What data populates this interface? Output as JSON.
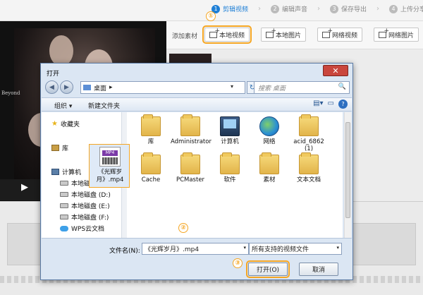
{
  "steps": [
    {
      "num": "1",
      "label": "剪辑视频"
    },
    {
      "num": "2",
      "label": "编辑声音"
    },
    {
      "num": "3",
      "label": "保存导出"
    },
    {
      "num": "4",
      "label": "上传分享"
    }
  ],
  "step_arrow": "›",
  "preview": {
    "overlay_text": "Beyond",
    "play_glyph": "▶"
  },
  "add_bar": {
    "label": "添加素材",
    "buttons": [
      "本地视频",
      "本地图片",
      "网络视频",
      "网络图片"
    ]
  },
  "badges": {
    "one": "①",
    "two": "②",
    "three": "③"
  },
  "dialog": {
    "title": "打开",
    "close_glyph": "✕",
    "back_glyph": "◀",
    "forward_glyph": "▶",
    "address": "桌面",
    "address_arrow": "▸",
    "address_dropdown": "▾",
    "refresh_glyph": "↻",
    "search_placeholder": "搜索 桌面",
    "search_glyph": "🔍",
    "organize": "组织 ▾",
    "new_folder": "新建文件夹",
    "view_glyph": "▤▾",
    "preview_glyph": "▭",
    "help_glyph": "?",
    "nav": {
      "favorites": "收藏夹",
      "library": "库",
      "computer": "计算机",
      "drive_c": "本地磁盘 (C:)",
      "drive_d": "本地磁盘 (D:)",
      "drive_e": "本地磁盘 (E:)",
      "drive_f": "本地磁盘 (F:)",
      "wps": "WPS云文档"
    },
    "files": [
      {
        "name": "库",
        "icon": "library"
      },
      {
        "name": "Administrator",
        "icon": "folder"
      },
      {
        "name": "计算机",
        "icon": "computer"
      },
      {
        "name": "网络",
        "icon": "network"
      },
      {
        "name": "acid_6862 (1)",
        "icon": "folder"
      },
      {
        "name": "Cache",
        "icon": "folder"
      },
      {
        "name": "PCMaster",
        "icon": "folder"
      },
      {
        "name": "软件",
        "icon": "folder"
      },
      {
        "name": "素材",
        "icon": "folder"
      },
      {
        "name": "文本文档",
        "icon": "folder"
      }
    ],
    "selected_file": {
      "name": "《光辉岁月》.mp4",
      "tag": "MP4"
    },
    "filename_label": "文件名(N):",
    "filename_value": "《光辉岁月》.mp4",
    "filter_value": "所有支持的视频文件",
    "dropdown_glyph": "▾",
    "open_label": "打开(O)",
    "cancel_label": "取消"
  },
  "colors": {
    "accent": "#1e7fd6",
    "highlight": "#f5a623"
  }
}
